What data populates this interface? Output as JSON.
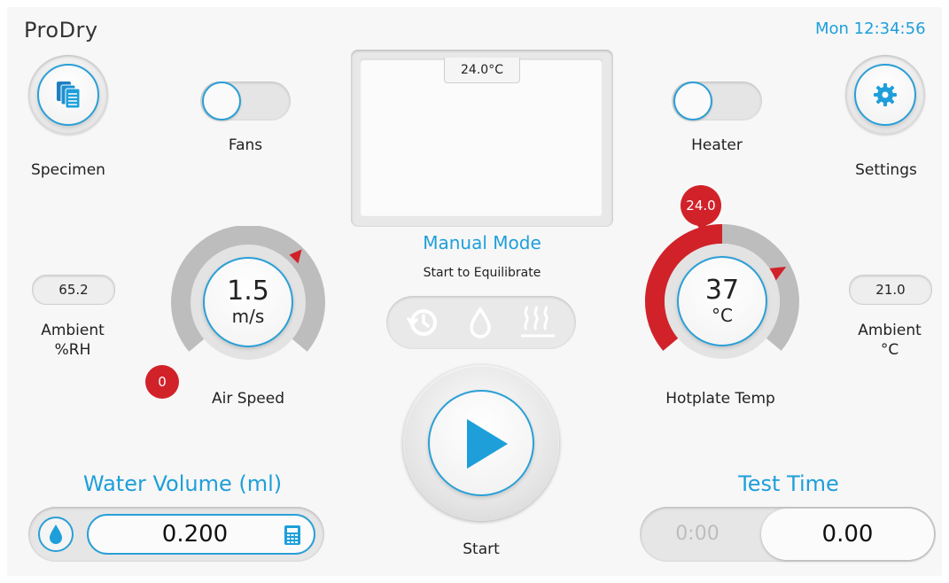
{
  "app": {
    "title": "ProDry",
    "clock": "Mon 12:34:56"
  },
  "buttons": {
    "specimen": {
      "label": "Specimen",
      "icon": "documents-icon"
    },
    "settings": {
      "label": "Settings",
      "icon": "gear-icon"
    }
  },
  "toggles": {
    "fans": {
      "label": "Fans",
      "state": "off"
    },
    "heater": {
      "label": "Heater",
      "state": "off"
    }
  },
  "display": {
    "temperature": "24.0°C"
  },
  "mode": {
    "title": "Manual Mode",
    "subtitle": "Start to Equilibrate"
  },
  "status_icons": [
    "history-icon",
    "water-drop-icon",
    "heat-icon"
  ],
  "start": {
    "label": "Start"
  },
  "ambient_rh": {
    "value": "65.2",
    "label_line1": "Ambient",
    "label_line2": "%RH"
  },
  "ambient_temp": {
    "value": "21.0",
    "label_line1": "Ambient",
    "label_line2": "°C"
  },
  "air_speed": {
    "value": "1.5",
    "unit": "m/s",
    "label": "Air Speed",
    "marker": "0"
  },
  "hotplate": {
    "value": "37",
    "unit": "°C",
    "label": "Hotplate Temp",
    "marker": "24.0"
  },
  "water_volume": {
    "title": "Water Volume (ml)",
    "value": "0.200"
  },
  "test_time": {
    "title": "Test Time",
    "elapsed": "0:00",
    "value": "0.00"
  },
  "colors": {
    "accent": "#1e9fda",
    "alert": "#d1222a"
  }
}
